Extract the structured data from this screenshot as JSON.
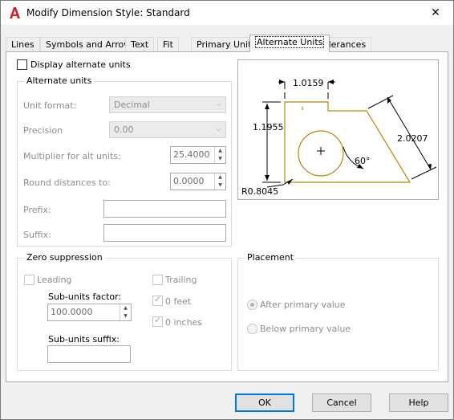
{
  "window": {
    "title": "Modify Dimension Style: Standard",
    "close_glyph": "✕"
  },
  "tabs": [
    "Lines",
    "Symbols and Arrows",
    "Text",
    "Fit",
    "Primary Units",
    "Alternate Units",
    "Tolerances"
  ],
  "display_alt": {
    "label": "Display alternate units",
    "checked": false
  },
  "alt_units": {
    "group_label": "Alternate units",
    "unit_format_label": "Unit format:",
    "unit_format_value": "Decimal",
    "precision_label": "Precision",
    "precision_value": "0.00",
    "multiplier_label": "Multiplier for alt units:",
    "multiplier_value": "25.4000",
    "round_label": "Round distances  to:",
    "round_value": "0.0000",
    "prefix_label": "Prefix:",
    "prefix_value": "",
    "suffix_label": "Suffix:",
    "suffix_value": ""
  },
  "zero_suppression": {
    "group_label": "Zero suppression",
    "leading_label": "Leading",
    "trailing_label": "Trailing",
    "subunits_factor_label": "Sub-units factor:",
    "subunits_factor_value": "100.0000",
    "zero_feet_label": "0 feet",
    "zero_inches_label": "0 inches",
    "subunits_suffix_label": "Sub-units suffix:",
    "subunits_suffix_value": ""
  },
  "placement": {
    "group_label": "Placement",
    "after_label": "After primary value",
    "below_label": "Below primary value"
  },
  "preview": {
    "dim_top": "1.0159",
    "dim_left": "1.1955",
    "dim_right": "2.0207",
    "dim_angle": "60°",
    "dim_radius": "R0.8045"
  },
  "buttons": {
    "ok": "OK",
    "cancel": "Cancel",
    "help": "Help"
  },
  "colors": {
    "accent": "#0078d7",
    "part_outline": "#b8860b",
    "autocad_red": "#d21f25"
  }
}
